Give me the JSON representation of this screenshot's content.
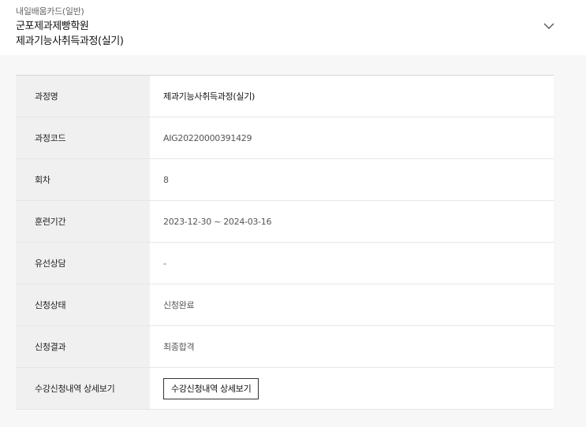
{
  "header": {
    "card_type": "내일배움카드(일반)",
    "academy": "군포제과제빵학원",
    "course": "제과기능사취득과정(실기)",
    "toggle_icon": "chevron-down-icon"
  },
  "details": {
    "course_name_label": "과정명",
    "course_name_value": "제과기능사취득과정(실기)",
    "course_code_label": "과정코드",
    "course_code_value": "AIG20220000391429",
    "session_label": "회차",
    "session_value": "8",
    "period_label": "훈련기간",
    "period_value": "2023-12-30 ~ 2024-03-16",
    "phone_consult_label": "유선상담",
    "phone_consult_value": "-",
    "status_label": "신청상태",
    "status_value": "신청완료",
    "result_label": "신청결과",
    "result_value": "최종합격",
    "history_label": "수강신청내역 상세보기",
    "history_button": "수강신청내역 상세보기"
  }
}
